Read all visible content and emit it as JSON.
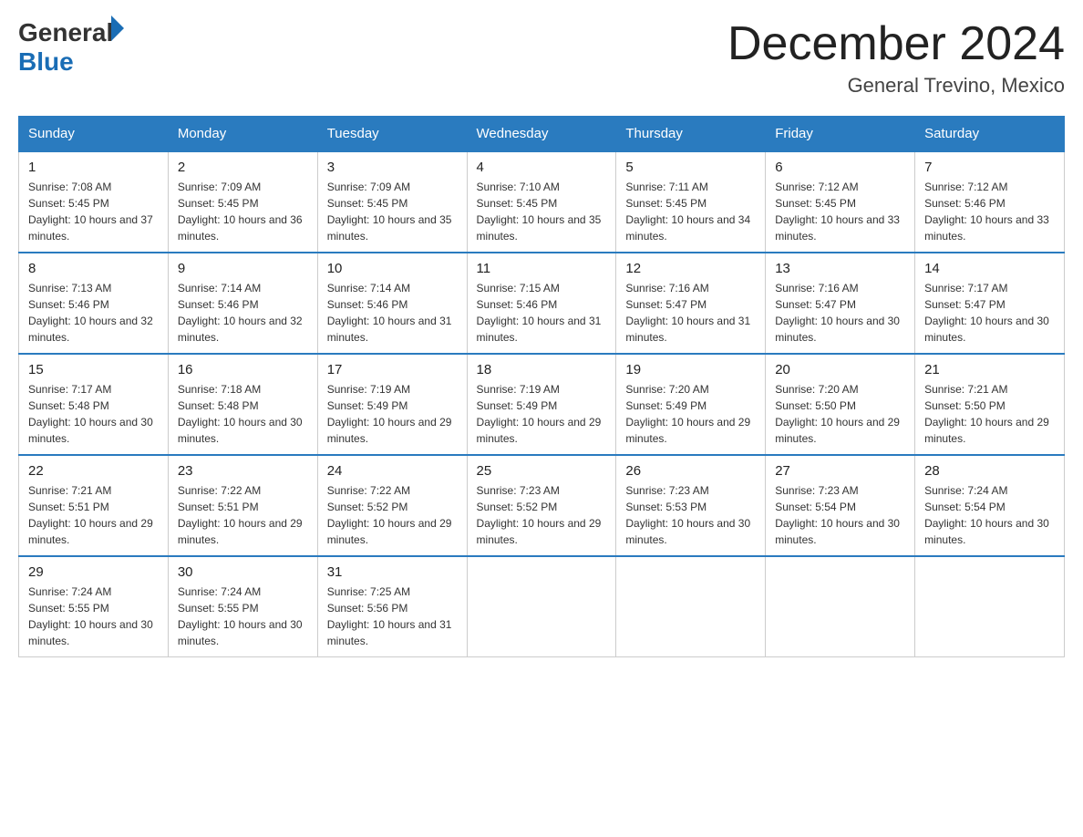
{
  "header": {
    "logo": {
      "text_general": "General",
      "text_blue": "Blue"
    },
    "title": "December 2024",
    "subtitle": "General Trevino, Mexico"
  },
  "calendar": {
    "days_of_week": [
      "Sunday",
      "Monday",
      "Tuesday",
      "Wednesday",
      "Thursday",
      "Friday",
      "Saturday"
    ],
    "weeks": [
      [
        {
          "day": "1",
          "sunrise": "7:08 AM",
          "sunset": "5:45 PM",
          "daylight": "10 hours and 37 minutes."
        },
        {
          "day": "2",
          "sunrise": "7:09 AM",
          "sunset": "5:45 PM",
          "daylight": "10 hours and 36 minutes."
        },
        {
          "day": "3",
          "sunrise": "7:09 AM",
          "sunset": "5:45 PM",
          "daylight": "10 hours and 35 minutes."
        },
        {
          "day": "4",
          "sunrise": "7:10 AM",
          "sunset": "5:45 PM",
          "daylight": "10 hours and 35 minutes."
        },
        {
          "day": "5",
          "sunrise": "7:11 AM",
          "sunset": "5:45 PM",
          "daylight": "10 hours and 34 minutes."
        },
        {
          "day": "6",
          "sunrise": "7:12 AM",
          "sunset": "5:45 PM",
          "daylight": "10 hours and 33 minutes."
        },
        {
          "day": "7",
          "sunrise": "7:12 AM",
          "sunset": "5:46 PM",
          "daylight": "10 hours and 33 minutes."
        }
      ],
      [
        {
          "day": "8",
          "sunrise": "7:13 AM",
          "sunset": "5:46 PM",
          "daylight": "10 hours and 32 minutes."
        },
        {
          "day": "9",
          "sunrise": "7:14 AM",
          "sunset": "5:46 PM",
          "daylight": "10 hours and 32 minutes."
        },
        {
          "day": "10",
          "sunrise": "7:14 AM",
          "sunset": "5:46 PM",
          "daylight": "10 hours and 31 minutes."
        },
        {
          "day": "11",
          "sunrise": "7:15 AM",
          "sunset": "5:46 PM",
          "daylight": "10 hours and 31 minutes."
        },
        {
          "day": "12",
          "sunrise": "7:16 AM",
          "sunset": "5:47 PM",
          "daylight": "10 hours and 31 minutes."
        },
        {
          "day": "13",
          "sunrise": "7:16 AM",
          "sunset": "5:47 PM",
          "daylight": "10 hours and 30 minutes."
        },
        {
          "day": "14",
          "sunrise": "7:17 AM",
          "sunset": "5:47 PM",
          "daylight": "10 hours and 30 minutes."
        }
      ],
      [
        {
          "day": "15",
          "sunrise": "7:17 AM",
          "sunset": "5:48 PM",
          "daylight": "10 hours and 30 minutes."
        },
        {
          "day": "16",
          "sunrise": "7:18 AM",
          "sunset": "5:48 PM",
          "daylight": "10 hours and 30 minutes."
        },
        {
          "day": "17",
          "sunrise": "7:19 AM",
          "sunset": "5:49 PM",
          "daylight": "10 hours and 29 minutes."
        },
        {
          "day": "18",
          "sunrise": "7:19 AM",
          "sunset": "5:49 PM",
          "daylight": "10 hours and 29 minutes."
        },
        {
          "day": "19",
          "sunrise": "7:20 AM",
          "sunset": "5:49 PM",
          "daylight": "10 hours and 29 minutes."
        },
        {
          "day": "20",
          "sunrise": "7:20 AM",
          "sunset": "5:50 PM",
          "daylight": "10 hours and 29 minutes."
        },
        {
          "day": "21",
          "sunrise": "7:21 AM",
          "sunset": "5:50 PM",
          "daylight": "10 hours and 29 minutes."
        }
      ],
      [
        {
          "day": "22",
          "sunrise": "7:21 AM",
          "sunset": "5:51 PM",
          "daylight": "10 hours and 29 minutes."
        },
        {
          "day": "23",
          "sunrise": "7:22 AM",
          "sunset": "5:51 PM",
          "daylight": "10 hours and 29 minutes."
        },
        {
          "day": "24",
          "sunrise": "7:22 AM",
          "sunset": "5:52 PM",
          "daylight": "10 hours and 29 minutes."
        },
        {
          "day": "25",
          "sunrise": "7:23 AM",
          "sunset": "5:52 PM",
          "daylight": "10 hours and 29 minutes."
        },
        {
          "day": "26",
          "sunrise": "7:23 AM",
          "sunset": "5:53 PM",
          "daylight": "10 hours and 30 minutes."
        },
        {
          "day": "27",
          "sunrise": "7:23 AM",
          "sunset": "5:54 PM",
          "daylight": "10 hours and 30 minutes."
        },
        {
          "day": "28",
          "sunrise": "7:24 AM",
          "sunset": "5:54 PM",
          "daylight": "10 hours and 30 minutes."
        }
      ],
      [
        {
          "day": "29",
          "sunrise": "7:24 AM",
          "sunset": "5:55 PM",
          "daylight": "10 hours and 30 minutes."
        },
        {
          "day": "30",
          "sunrise": "7:24 AM",
          "sunset": "5:55 PM",
          "daylight": "10 hours and 30 minutes."
        },
        {
          "day": "31",
          "sunrise": "7:25 AM",
          "sunset": "5:56 PM",
          "daylight": "10 hours and 31 minutes."
        },
        null,
        null,
        null,
        null
      ]
    ]
  }
}
